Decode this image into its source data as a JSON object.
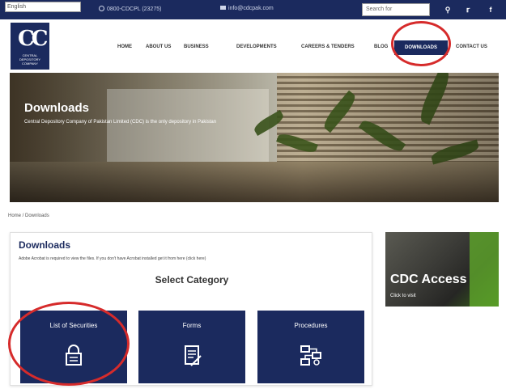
{
  "topbar": {
    "language": "English",
    "phone": "0800-CDCPL (23275)",
    "email": "info@cdcpak.com",
    "search_placeholder": "Search for",
    "icons": [
      "search-icon",
      "twitter-icon",
      "facebook-icon"
    ]
  },
  "logo": {
    "text": "CENTRAL DEPOSITORY COMPANY"
  },
  "nav": {
    "items": [
      "HOME",
      "ABOUT US",
      "BUSINESS",
      "DEVELOPMENTS",
      "CAREERS & TENDERS",
      "BLOG",
      "DOWNLOADS",
      "CONTACT US"
    ],
    "active": "DOWNLOADS"
  },
  "hero": {
    "title": "Downloads",
    "subtitle": "Central Depository Company of Pakistan Limited (CDC) is the only depository in Pakistan"
  },
  "breadcrumb": "Home / Downloads",
  "main": {
    "title": "Downloads",
    "description": "Adobe Acrobat is required to view the files. If you don't have Acrobat installed get it from here (click here)",
    "select_heading": "Select Category",
    "tiles": [
      {
        "label": "List of Securities",
        "icon": "lock-icon"
      },
      {
        "label": "Forms",
        "icon": "form-icon"
      },
      {
        "label": "Procedures",
        "icon": "procedure-icon"
      }
    ]
  },
  "sidebar": {
    "ad_title": "CDC Access",
    "ad_subtitle": "Click to visit"
  },
  "colors": {
    "navy": "#1b2a5e",
    "highlight_ring": "#d62b2b"
  }
}
